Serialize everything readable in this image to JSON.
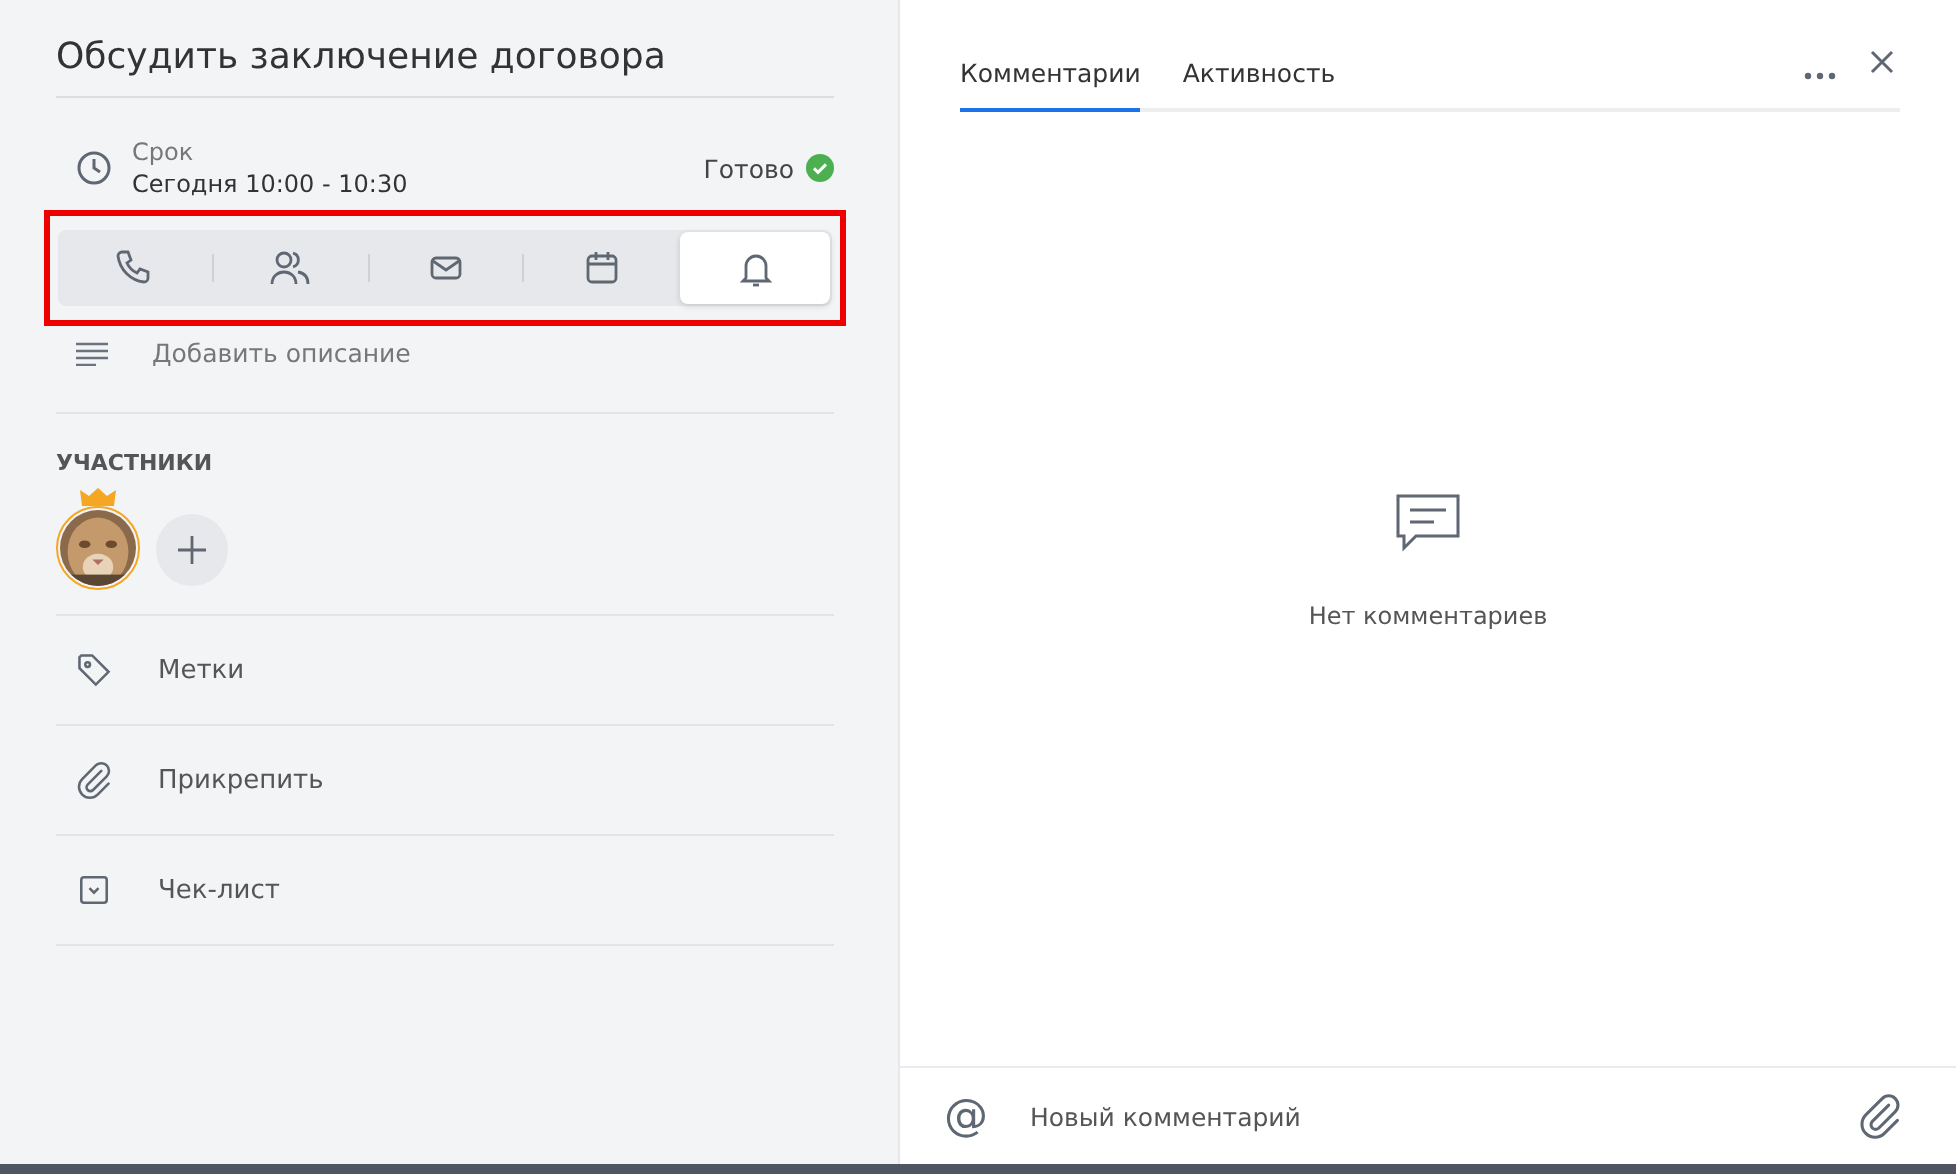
{
  "task": {
    "title": "Обсудить заключение договора",
    "deadline_label": "Срок",
    "deadline_value": "Сегодня 10:00 - 10:30",
    "status": "Готово",
    "done": true
  },
  "type_toolbar": {
    "highlighted": true,
    "items": [
      {
        "kind": "phone",
        "selected": false
      },
      {
        "kind": "people",
        "selected": false
      },
      {
        "kind": "mail",
        "selected": false
      },
      {
        "kind": "calendar",
        "selected": false
      },
      {
        "kind": "bell",
        "selected": true
      }
    ]
  },
  "description": {
    "placeholder": "Добавить описание"
  },
  "participants": {
    "heading": "УЧАСТНИКИ",
    "members": [
      {
        "kind": "picture",
        "owner": true
      }
    ]
  },
  "actions": [
    {
      "kind": "tag",
      "label": "Метки"
    },
    {
      "kind": "attach",
      "label": "Прикрепить"
    },
    {
      "kind": "checklist",
      "label": "Чек-лист"
    }
  ],
  "tabs": [
    {
      "label": "Комментарии",
      "selected": true
    },
    {
      "label": "Активность",
      "selected": false
    }
  ],
  "empty_state": "Нет комментариев",
  "composer": {
    "mention": "@",
    "placeholder": "Новый комментарий"
  }
}
